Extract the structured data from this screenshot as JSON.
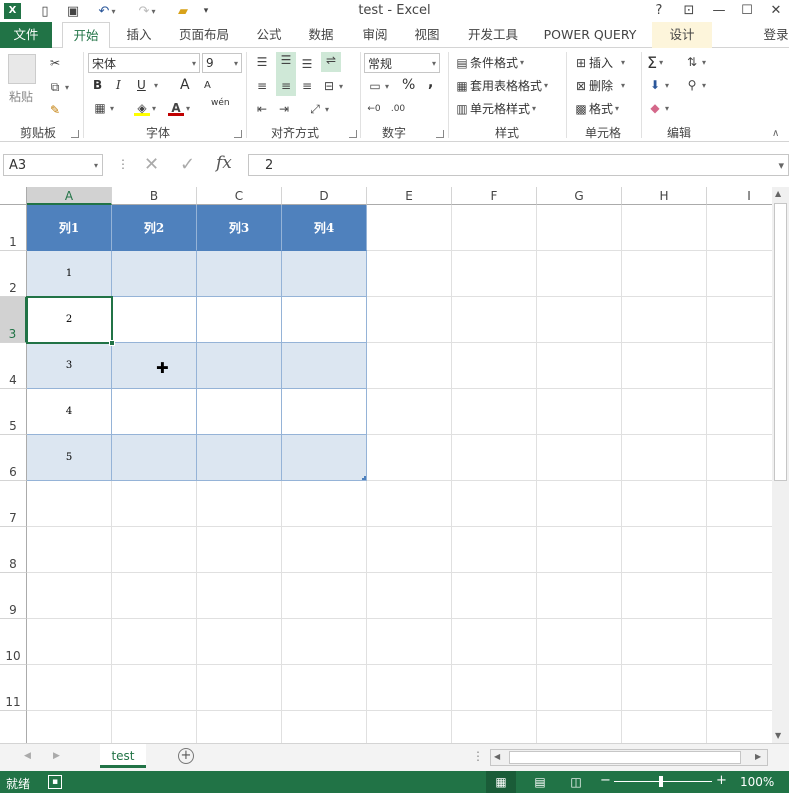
{
  "window": {
    "title": "test - Excel",
    "login": "登录",
    "help": "?"
  },
  "tabs": [
    {
      "label": "文件"
    },
    {
      "label": "开始"
    },
    {
      "label": "插入"
    },
    {
      "label": "页面布局"
    },
    {
      "label": "公式"
    },
    {
      "label": "数据"
    },
    {
      "label": "审阅"
    },
    {
      "label": "视图"
    },
    {
      "label": "开发工具"
    },
    {
      "label": "POWER QUERY"
    },
    {
      "label": "设计"
    }
  ],
  "ribbon": {
    "clipboard": {
      "label": "剪贴板",
      "paste": "粘贴"
    },
    "font": {
      "label": "字体",
      "name": "宋体",
      "size": "9",
      "bold": "B",
      "italic": "I",
      "underline": "U",
      "grow": "A",
      "shrink": "A",
      "phonetic": "wén"
    },
    "alignment": {
      "label": "对齐方式"
    },
    "number": {
      "label": "数字",
      "format": "常规",
      "percent": "%",
      "comma": ","
    },
    "styles": {
      "label": "样式",
      "conditional": "条件格式",
      "table": "套用表格格式",
      "cell": "单元格样式"
    },
    "cells": {
      "label": "单元格",
      "insert": "插入",
      "delete": "删除",
      "format": "格式"
    },
    "editing": {
      "label": "编辑"
    }
  },
  "formula_bar": {
    "name_box": "A3",
    "value": "2",
    "fx": "fx"
  },
  "grid": {
    "columns": [
      "A",
      "B",
      "C",
      "D",
      "E",
      "F",
      "G",
      "H",
      "I"
    ],
    "rows": [
      "1",
      "2",
      "3",
      "4",
      "5",
      "6",
      "7",
      "8",
      "9",
      "10",
      "11"
    ],
    "table_headers": [
      "列1",
      "列2",
      "列3",
      "列4"
    ],
    "table_col1": [
      "1",
      "2",
      "3",
      "4",
      "5"
    ],
    "selected_cell": "A3"
  },
  "sheets": {
    "tabs": [
      "test"
    ]
  },
  "status": {
    "ready": "就绪",
    "zoom": "100%"
  },
  "colors": {
    "accent": "#217346",
    "table_header": "#4f81bd",
    "table_band": "#dce6f1"
  }
}
